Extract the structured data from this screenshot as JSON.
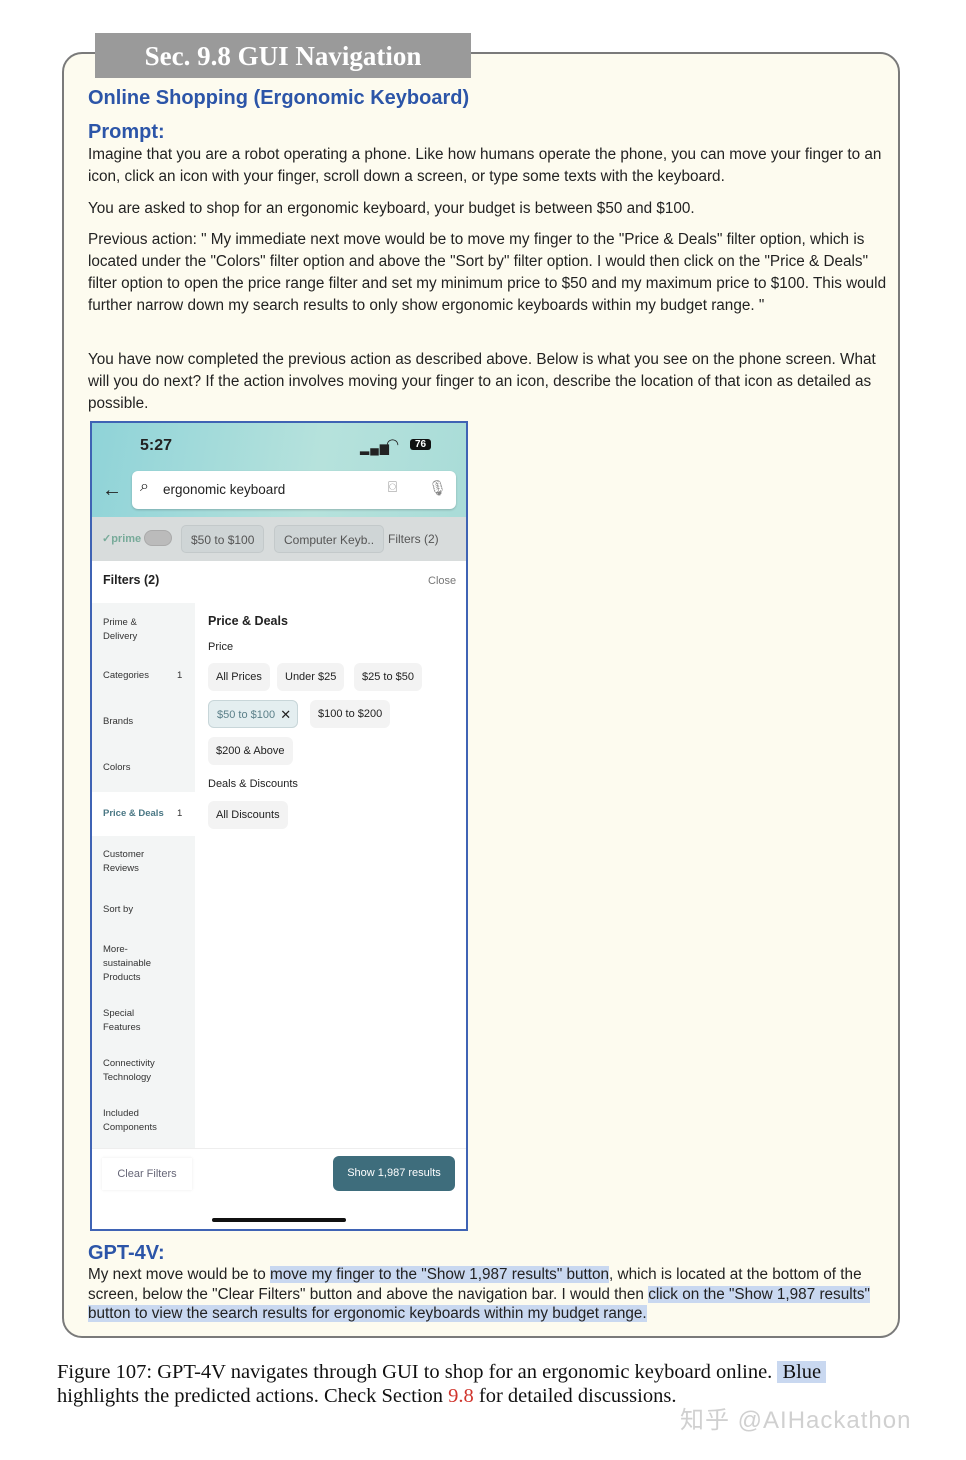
{
  "section_label": "Sec. 9.8 GUI Navigation",
  "title": "Online Shopping (Ergonomic Keyboard)",
  "prompt_heading": "Prompt:",
  "prompt_paragraphs": [
    "Imagine that you are a robot operating a phone. Like how humans operate the phone, you can move your finger to an icon, click an icon with your finger, scroll down a screen, or type some texts with the keyboard.",
    "You are asked to shop for an ergonomic keyboard, your budget is between $50 and $100.",
    "Previous action: \" My immediate next move would be to move my finger to the \"Price & Deals\" filter option, which is located under the \"Colors\" filter option and above the \"Sort by\" filter option. I would then click on the \"Price & Deals\" filter option to open the price range filter and set my minimum price to $50 and my maximum price to $100. This would further narrow down my search results to only show ergonomic keyboards within my budget range. \"",
    "You have now completed the previous action as described above. Below is what you see on the phone screen. What will you do next? If the action involves moving your finger to an icon, describe the location of that icon as detailed as possible."
  ],
  "phone": {
    "time": "5:27",
    "battery": "76",
    "search_value": "ergonomic keyboard",
    "chips": {
      "prime": "✓prime",
      "price": "$50 to $100",
      "category": "Computer Keyb..",
      "filters": "Filters (2)"
    },
    "sheet_title": "Filters (2)",
    "close": "Close",
    "sidebar": [
      {
        "label": "Prime & Delivery",
        "count": ""
      },
      {
        "label": "Categories",
        "count": "1"
      },
      {
        "label": "Brands",
        "count": ""
      },
      {
        "label": "Colors",
        "count": ""
      },
      {
        "label": "Price & Deals",
        "count": "1",
        "selected": true
      },
      {
        "label": "Customer Reviews",
        "count": ""
      },
      {
        "label": "Sort by",
        "count": ""
      },
      {
        "label": "More-sustainable Products",
        "count": ""
      },
      {
        "label": "Special Features",
        "count": ""
      },
      {
        "label": "Connectivity Technology",
        "count": ""
      },
      {
        "label": "Included Components",
        "count": ""
      }
    ],
    "section_title": "Price & Deals",
    "price_label": "Price",
    "price_options": [
      "All Prices",
      "Under $25",
      "$25 to $50",
      "$50 to $100",
      "$100 to $200",
      "$200 & Above"
    ],
    "deals_label": "Deals & Discounts",
    "deals_options": [
      "All Discounts"
    ],
    "clear_filters": "Clear Filters",
    "show_results": "Show 1,987 results"
  },
  "answer_heading": "GPT-4V:",
  "answer_parts": [
    {
      "text": "My next move would be to ",
      "highlight": false
    },
    {
      "text": "move my finger to the \"Show 1,987 results\" button",
      "highlight": true
    },
    {
      "text": ", which is located at the bottom of the screen, below the \"Clear Filters\" button and above the navigation bar. I would then ",
      "highlight": false
    },
    {
      "text": "click on the \"Show 1,987 results\" button to view the search results for ergonomic keyboards within my budget range.",
      "highlight": true
    }
  ],
  "caption": {
    "prefix": "Figure 107:  GPT-4V navigates through GUI to shop for an ergonomic keyboard online.  ",
    "blue": "Blue",
    "middle": " highlights the predicted actions. Check Section ",
    "ref": "9.8",
    "suffix": " for detailed discussions."
  },
  "watermark": "知乎 @AIHackathon",
  "colors": {
    "heading": "#2c55a8",
    "highlight": "#c9d8f0",
    "button": "#3e6d7c",
    "ref": "#d0342c"
  }
}
